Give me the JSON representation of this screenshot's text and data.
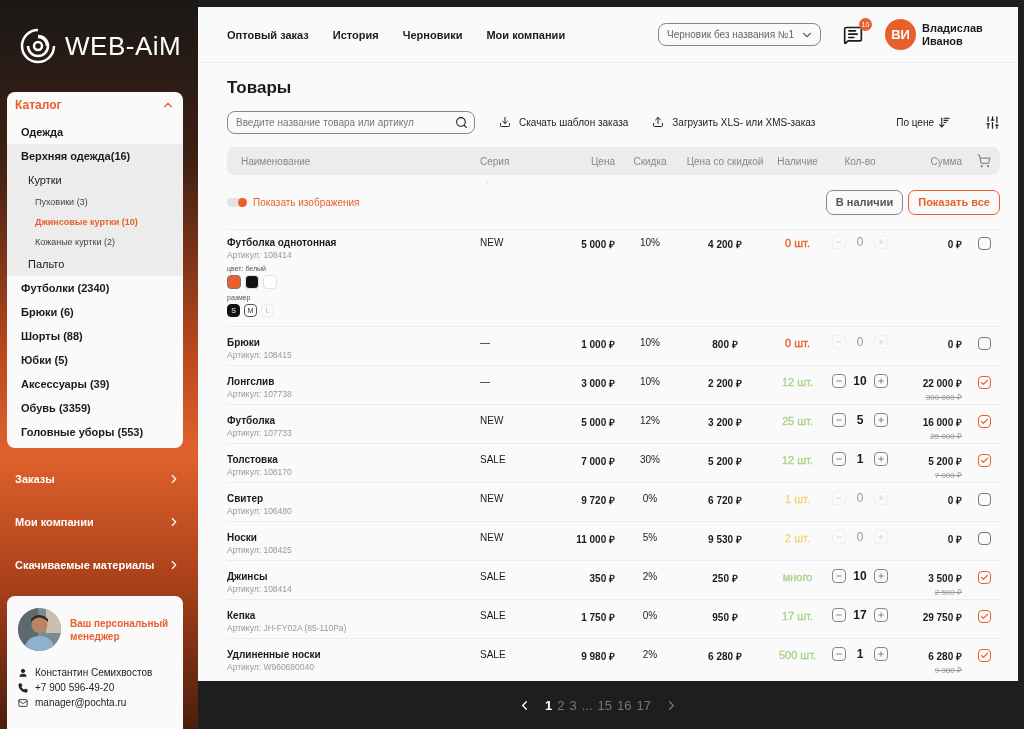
{
  "logo": {
    "text": "WEB-AiM"
  },
  "catalog": {
    "title": "Каталог",
    "expanded": true,
    "items": [
      {
        "label": "Одежда",
        "selected": false
      },
      {
        "label": "Верхняя одежда(16)",
        "selected": false,
        "expanded": true,
        "children": [
          {
            "label": "Куртки",
            "selected": false,
            "children": [
              {
                "label": "Пуховики (3)",
                "selected": false
              },
              {
                "label": "Джинсовые куртки (10)",
                "selected": true
              },
              {
                "label": "Кожаные куртки (2)",
                "selected": false
              }
            ]
          },
          {
            "label": "Пальто",
            "selected": false
          }
        ]
      },
      {
        "label": "Футболки (2340)",
        "selected": false
      },
      {
        "label": "Брюки (6)",
        "selected": false
      },
      {
        "label": "Шорты (88)",
        "selected": false
      },
      {
        "label": "Юбки (5)",
        "selected": false
      },
      {
        "label": "Аксессуары (39)",
        "selected": false
      },
      {
        "label": "Обувь (3359)",
        "selected": false
      },
      {
        "label": "Головные уборы (553)",
        "selected": false
      }
    ]
  },
  "sidebar_menu": [
    "Заказы",
    "Мои компании",
    "Скачиваемые материалы"
  ],
  "manager": {
    "title": "Ваш персональный менеджер",
    "name": "Константин Семихвостов",
    "phone": "+7 900 596-49-20",
    "email": "manager@pochta.ru"
  },
  "top_nav": [
    "Оптовый заказ",
    "История",
    "Черновики",
    "Мои компании"
  ],
  "draft_select": {
    "value": "Черновик без названия №1"
  },
  "messages": {
    "badge": "10"
  },
  "user": {
    "initials": "ВИ",
    "name": "Владислав Иванов"
  },
  "page_title": "Товары",
  "search": {
    "placeholder": "Введите название товара или артикул"
  },
  "actions": [
    "Скачать шаблон заказа",
    "Загрузить XLS- или XMS-заказ"
  ],
  "sort": {
    "label": "По цене"
  },
  "columns": [
    "Наименование",
    "Серия",
    "Цена",
    "Скидка",
    "Цена со скидкой",
    "Наличие",
    "Кол-во",
    "Сумма"
  ],
  "show_images": {
    "label": "Показать изображения",
    "on": true
  },
  "filters": [
    {
      "label": "В наличии",
      "selected": false
    },
    {
      "label": "Показать все",
      "selected": true
    }
  ],
  "rows": [
    {
      "name": "Футболка однотонная",
      "article": "Артикул: 108414",
      "series": "NEW",
      "price": "5 000 ₽",
      "discount": "10%",
      "discount_price": "4 200 ₽",
      "stock": {
        "text": "0 шт.",
        "color": "#e8602c"
      },
      "qty": "0",
      "disabled": true,
      "sum": "0 ₽",
      "checked": false,
      "options": {
        "color_label": "цвет: белый",
        "swatches": [
          {
            "color": "#e8602c",
            "selected": true
          },
          {
            "color": "#111111",
            "selected": false
          },
          {
            "color": "#ffffff",
            "selected": false
          }
        ],
        "size_label": "размер",
        "sizes": [
          {
            "label": "S",
            "selected": true,
            "disabled": false
          },
          {
            "label": "M",
            "selected": false,
            "disabled": false
          },
          {
            "label": "L",
            "selected": false,
            "disabled": true
          }
        ]
      }
    },
    {
      "name": "Брюки",
      "article": "Артикул: 108415",
      "series": "—",
      "price": "1 000 ₽",
      "discount": "10%",
      "discount_price": "800 ₽",
      "stock": {
        "text": "0 шт.",
        "color": "#e8602c"
      },
      "qty": "0",
      "disabled": true,
      "sum": "0 ₽",
      "checked": false
    },
    {
      "name": "Лонгслив",
      "article": "Артикул: 107738",
      "series": "—",
      "price": "3 000 ₽",
      "discount": "10%",
      "discount_price": "2 200 ₽",
      "stock": {
        "text": "12 шт.",
        "color": "#a9d48c"
      },
      "qty": "10",
      "disabled": false,
      "sum": "22 000 ₽",
      "old_sum": "300 000 ₽",
      "checked": true
    },
    {
      "name": "Футболка",
      "article": "Артикул: 107733",
      "series": "NEW",
      "price": "5 000 ₽",
      "discount": "12%",
      "discount_price": "3 200 ₽",
      "stock": {
        "text": "25 шт.",
        "color": "#a9d48c"
      },
      "qty": "5",
      "disabled": false,
      "sum": "16 000 ₽",
      "old_sum": "25 000 ₽",
      "checked": true
    },
    {
      "name": "Толстовка",
      "article": "Артикул: 108170",
      "series": "SALE",
      "price": "7 000 ₽",
      "discount": "30%",
      "discount_price": "5 200 ₽",
      "stock": {
        "text": "12 шт.",
        "color": "#a9d48c"
      },
      "qty": "1",
      "disabled": false,
      "sum": "5 200 ₽",
      "old_sum": "7 000 ₽",
      "checked": true
    },
    {
      "name": "Свитер",
      "article": "Артикул: 106480",
      "series": "NEW",
      "price": "9 720 ₽",
      "discount": "0%",
      "discount_price": "6 720 ₽",
      "stock": {
        "text": "1 шт.",
        "color": "#f3d77a"
      },
      "qty": "0",
      "disabled": true,
      "sum": "0 ₽",
      "checked": false
    },
    {
      "name": "Носки",
      "article": "Артикул: 108425",
      "series": "NEW",
      "price": "11 000 ₽",
      "discount": "5%",
      "discount_price": "9 530 ₽",
      "stock": {
        "text": "2 шт.",
        "color": "#f3d77a"
      },
      "qty": "0",
      "disabled": true,
      "sum": "0 ₽",
      "checked": false
    },
    {
      "name": "Джинсы",
      "article": "Артикул: 108414",
      "series": "SALE",
      "price": "350 ₽",
      "discount": "2%",
      "discount_price": "250 ₽",
      "stock": {
        "text": "много",
        "color": "#a9d48c"
      },
      "qty": "10",
      "disabled": false,
      "sum": "3 500 ₽",
      "old_sum": "2 500 ₽",
      "checked": true
    },
    {
      "name": "Кепка",
      "article": "Артикул: JH-FY02A (85-110Pa)",
      "series": "SALE",
      "price": "1 750 ₽",
      "discount": "0%",
      "discount_price": "950 ₽",
      "stock": {
        "text": "17 шт.",
        "color": "#a9d48c"
      },
      "qty": "17",
      "disabled": false,
      "sum": "29 750 ₽",
      "checked": true
    },
    {
      "name": "Удлиненные носки",
      "article": "Артикул: W960680040",
      "series": "SALE",
      "price": "9 980 ₽",
      "discount": "2%",
      "discount_price": "6 280 ₽",
      "stock": {
        "text": "500 шт.",
        "color": "#a9d48c"
      },
      "qty": "1",
      "disabled": false,
      "sum": "6 280 ₽",
      "old_sum": "9 980 ₽",
      "checked": true
    }
  ],
  "pagination": {
    "pages": [
      {
        "label": "1",
        "selected": true
      },
      {
        "label": "2",
        "selected": false
      },
      {
        "label": "3",
        "selected": false
      },
      {
        "label": "...",
        "selected": false
      },
      {
        "label": "15",
        "selected": false
      },
      {
        "label": "16",
        "selected": false
      },
      {
        "label": "17",
        "selected": false
      }
    ]
  }
}
